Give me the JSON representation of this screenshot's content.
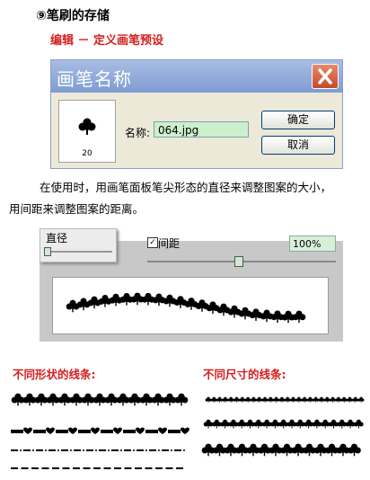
{
  "heading": "⑨笔刷的存储",
  "subheading": "编辑 － 定义画笔预设",
  "dialog": {
    "title": "画笔名称",
    "brush_size": "20",
    "name_label": "名称:",
    "name_value": "064.jpg",
    "ok_label": "确定",
    "cancel_label": "取消"
  },
  "paragraph": {
    "line1": "在使用时，用画笔面板笔尖形态的直径来调整图案的大小，",
    "line2": "用间距来调整图案的距离。"
  },
  "brush_panel": {
    "diameter_label": "直径",
    "spacing_checked": true,
    "spacing_checkmark": "✓",
    "spacing_label": "间距",
    "spacing_value": "100%"
  },
  "captions": {
    "different_shapes": "不同形状的线条:",
    "different_sizes": "不同尺寸的线条:"
  }
}
